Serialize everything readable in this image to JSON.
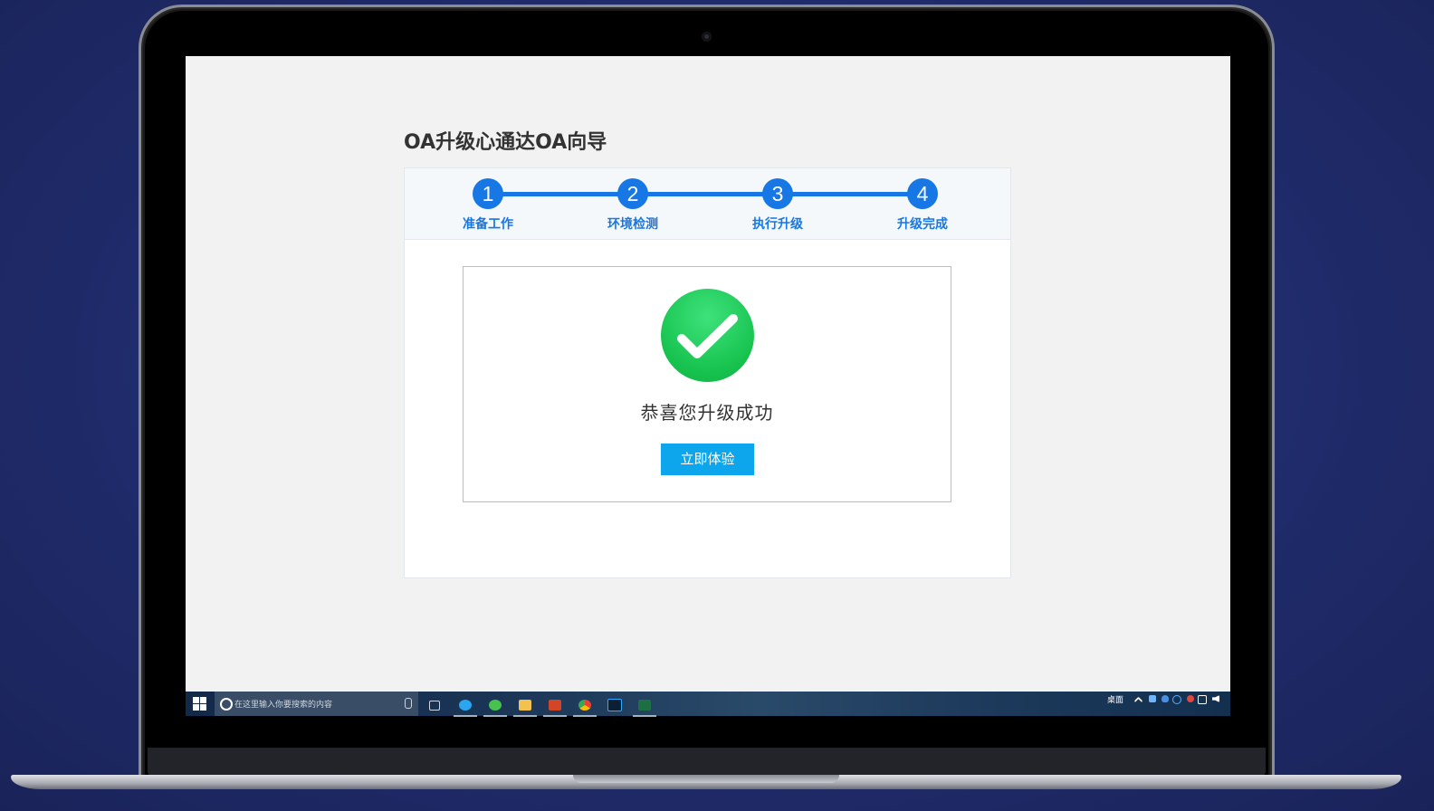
{
  "page": {
    "title": "OA升级心通达OA向导"
  },
  "wizard": {
    "steps": [
      {
        "number": "1",
        "label": "准备工作"
      },
      {
        "number": "2",
        "label": "环境检测"
      },
      {
        "number": "3",
        "label": "执行升级"
      },
      {
        "number": "4",
        "label": "升级完成"
      }
    ],
    "current_step": 4,
    "result": {
      "icon": "checkmark-icon",
      "message": "恭喜您升级成功",
      "button_label": "立即体验"
    }
  },
  "taskbar": {
    "search_placeholder": "在这里输入你要搜索的内容",
    "pinned_apps": [
      "task-view-icon",
      "browser-icon",
      "wechat-icon",
      "file-explorer-icon",
      "powerpoint-icon",
      "chrome-icon",
      "photoshop-icon",
      "excel-icon"
    ],
    "tray_label": "桌面"
  },
  "colors": {
    "accent": "#1677e5",
    "button": "#0da5ec",
    "success": "#16c24e"
  }
}
